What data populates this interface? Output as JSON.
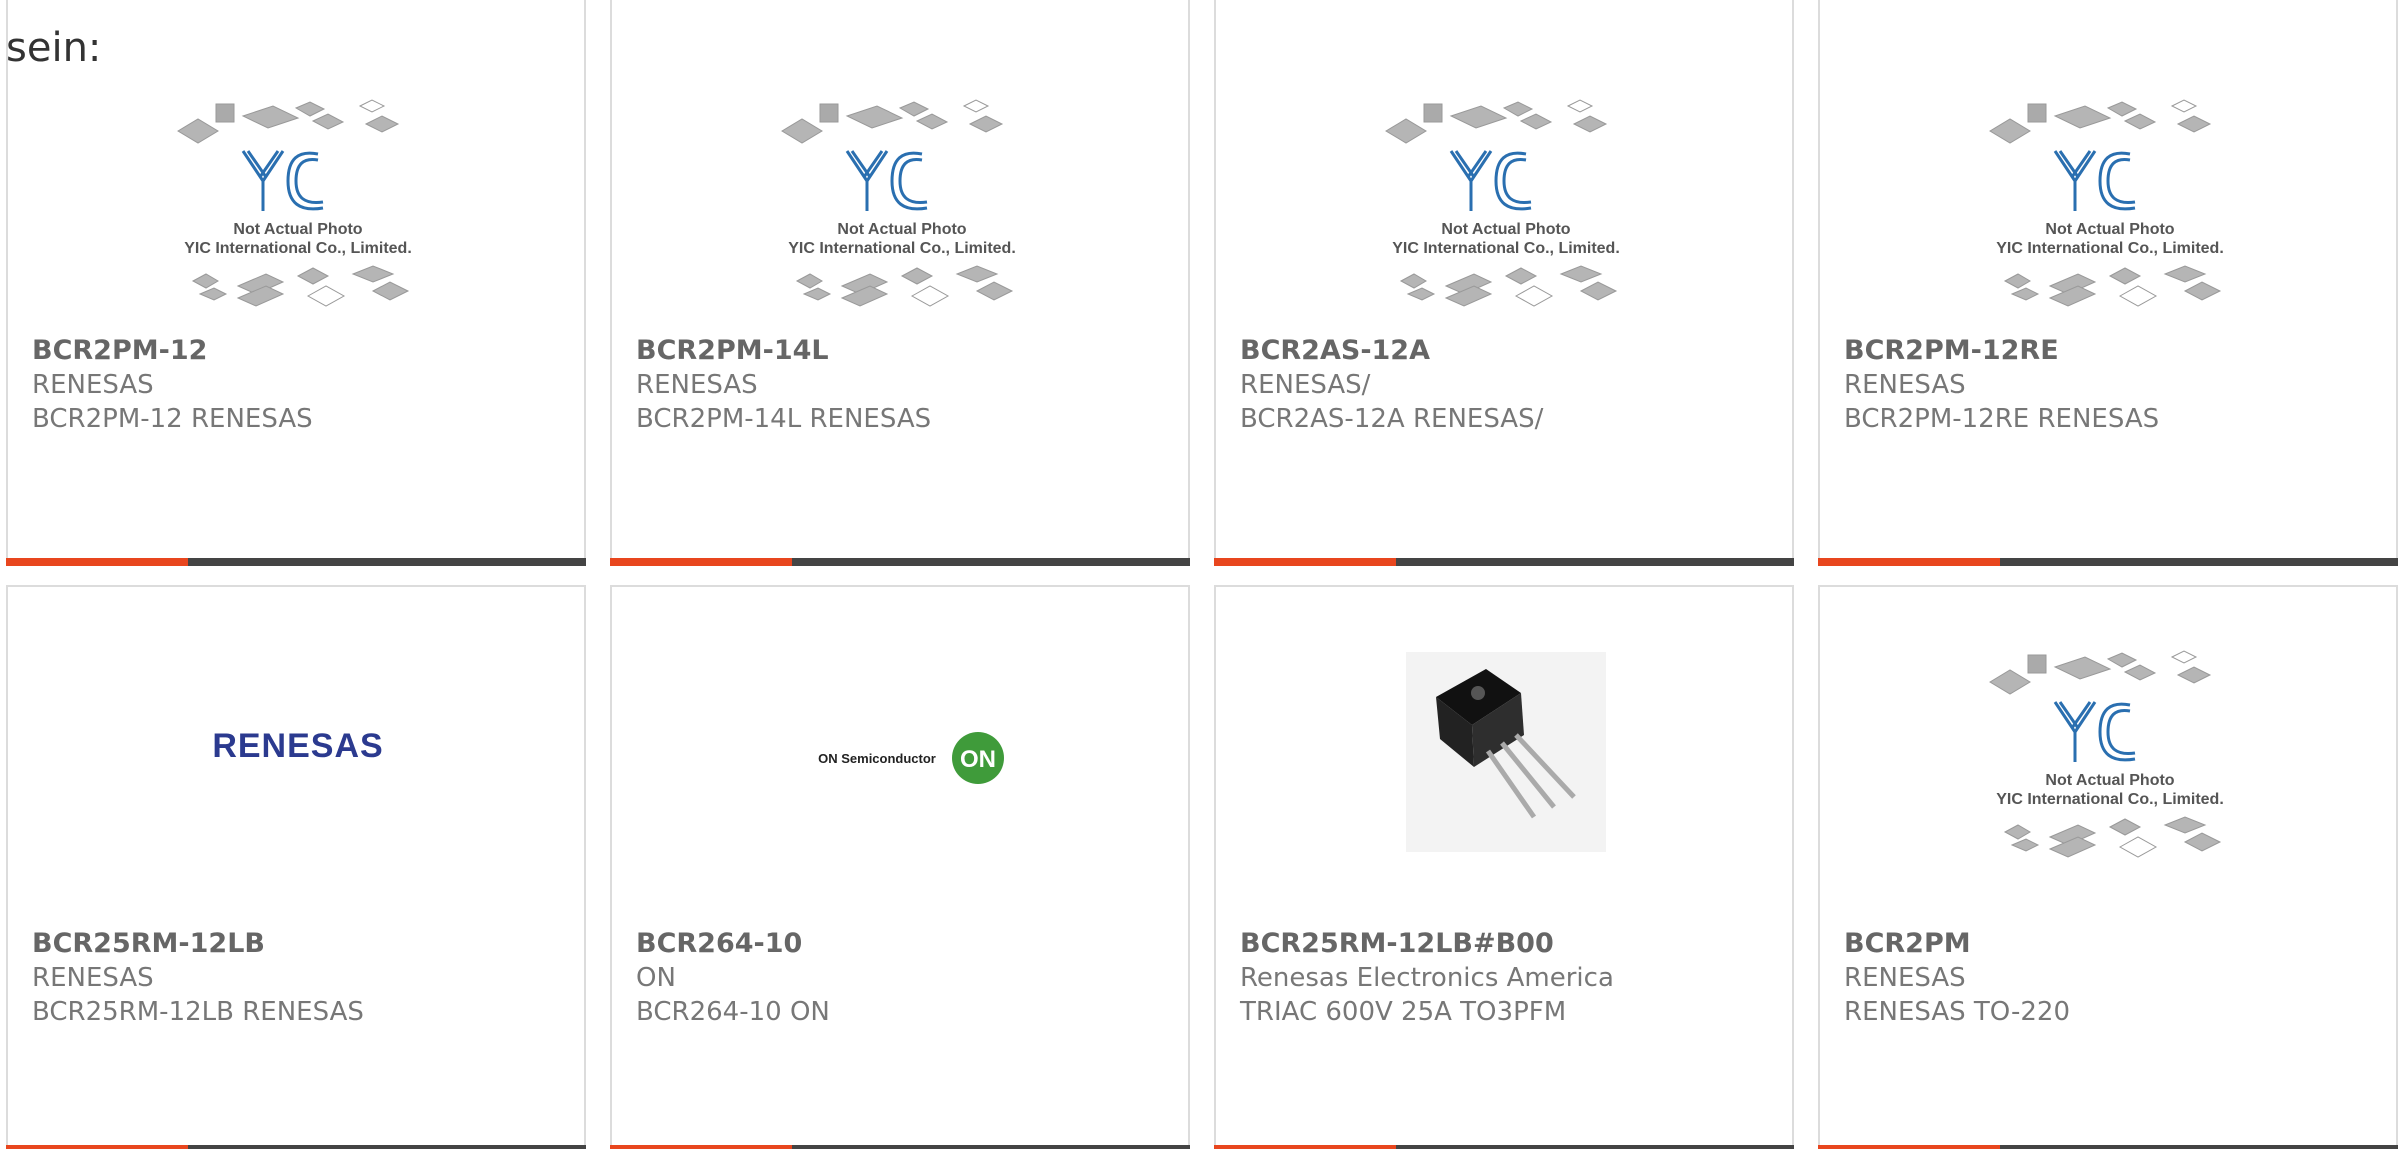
{
  "intro_text": "sein:",
  "placeholder": {
    "line1": "Not Actual Photo",
    "line2": "YIC International Co., Limited."
  },
  "colors": {
    "accent": "#e8461e",
    "stripe": "#444444",
    "yic_blue": "#2a6fb0"
  },
  "products": [
    {
      "part": "BCR2PM-12",
      "maker": "RENESAS",
      "desc": "BCR2PM-12 RENESAS",
      "image": "yic-placeholder"
    },
    {
      "part": "BCR2PM-14L",
      "maker": "RENESAS",
      "desc": "BCR2PM-14L RENESAS",
      "image": "yic-placeholder"
    },
    {
      "part": "BCR2AS-12A",
      "maker": "RENESAS/",
      "desc": "BCR2AS-12A RENESAS/",
      "image": "yic-placeholder"
    },
    {
      "part": "BCR2PM-12RE",
      "maker": "RENESAS",
      "desc": "BCR2PM-12RE RENESAS",
      "image": "yic-placeholder"
    },
    {
      "part": "BCR25RM-12LB",
      "maker": "RENESAS",
      "desc": "BCR25RM-12LB RENESAS",
      "image": "renesas-logo",
      "logo_text": "RENESAS"
    },
    {
      "part": "BCR264-10",
      "maker": "ON",
      "desc": "BCR264-10 ON",
      "image": "on-semi-logo",
      "logo_text": "ON Semiconductor",
      "logo_badge": "ON"
    },
    {
      "part": "BCR25RM-12LB#B00",
      "maker": "Renesas Electronics America",
      "desc": "TRIAC 600V 25A TO3PFM",
      "image": "to3p-package-photo"
    },
    {
      "part": "BCR2PM",
      "maker": "RENESAS",
      "desc": "RENESAS TO-220",
      "image": "yic-placeholder"
    }
  ]
}
